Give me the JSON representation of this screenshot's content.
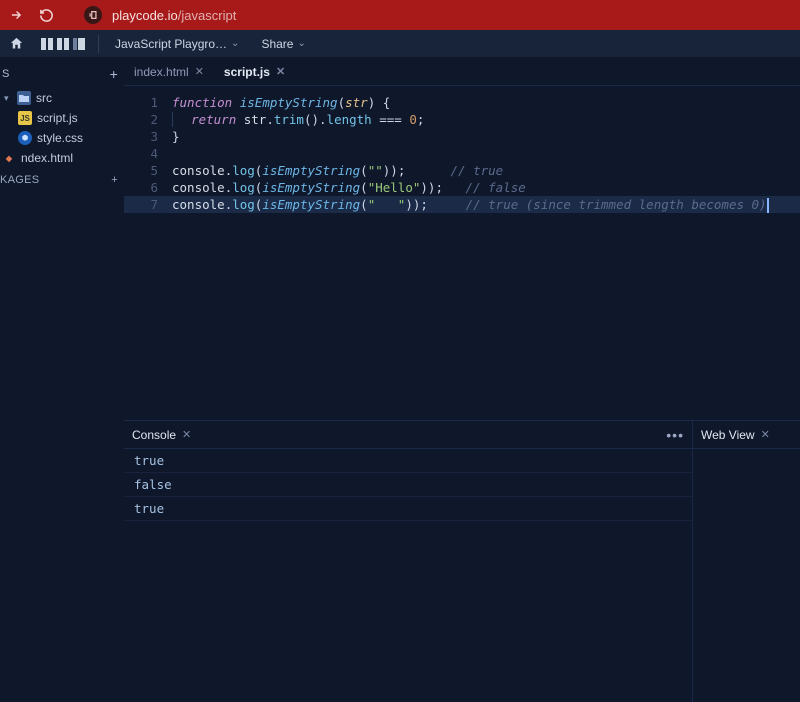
{
  "browser": {
    "url_host": "playcode.io",
    "url_path": "/javascript"
  },
  "toolbar": {
    "project_dropdown": "JavaScript Playgro…",
    "share_dropdown": "Share"
  },
  "sidebar": {
    "files_header": "S",
    "packages_header": "KAGES",
    "tree": {
      "root_folder": "src",
      "script_file": "script.js",
      "style_file": "style.css",
      "index_file": "ndex.html"
    }
  },
  "editor": {
    "tabs": [
      {
        "label": "index.html",
        "active": false
      },
      {
        "label": "script.js",
        "active": true
      }
    ],
    "lines": {
      "1": {
        "n": "1"
      },
      "2": {
        "n": "2"
      },
      "3": {
        "n": "3"
      },
      "4": {
        "n": "4"
      },
      "5": {
        "n": "5"
      },
      "6": {
        "n": "6"
      },
      "7": {
        "n": "7"
      }
    },
    "code": {
      "kw_function": "function",
      "fn_name": "isEmptyString",
      "param": "str",
      "kw_return": "return",
      "prop_trim": "trim",
      "prop_length": "length",
      "op_eq": "===",
      "num_zero": "0",
      "obj_console": "console",
      "prop_log": "log",
      "str_empty": "\"\"",
      "str_hello": "\"Hello\"",
      "str_spaces": "\"   \"",
      "cmt_true": "// true",
      "cmt_false": "// false",
      "cmt_long": "// true (since trimmed length becomes 0)"
    }
  },
  "console": {
    "tab_label": "Console",
    "lines": [
      "true",
      "false",
      "true"
    ]
  },
  "webview": {
    "tab_label": "Web View"
  }
}
